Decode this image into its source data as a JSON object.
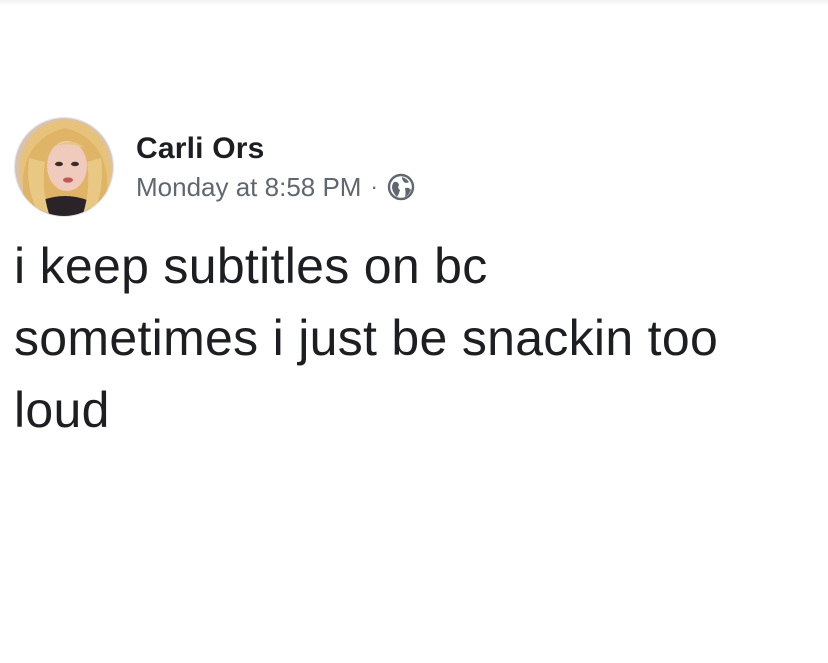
{
  "post": {
    "author": {
      "name": "Carli Ors",
      "avatar_icon": "profile-photo"
    },
    "timestamp": "Monday at 8:58 PM",
    "separator": "·",
    "privacy_icon": "globe-icon",
    "text_lines": [
      "i keep subtitles on bc",
      "sometimes i just be snackin too",
      "loud"
    ]
  },
  "colors": {
    "text": "#1c1e21",
    "secondary_text": "#616770",
    "background": "#ffffff"
  }
}
